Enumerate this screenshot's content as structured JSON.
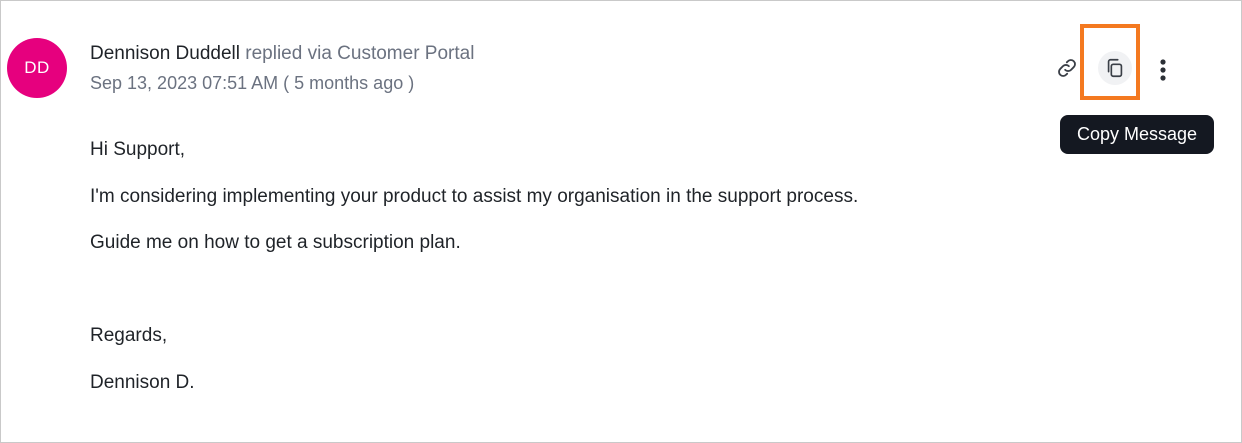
{
  "message": {
    "avatar_initials": "DD",
    "author": "Dennison Duddell",
    "action": "replied",
    "via": "via Customer Portal",
    "timestamp": "Sep 13, 2023 07:51 AM ( 5 months ago )",
    "body_lines": [
      "Hi Support,",
      "I'm considering implementing your product to assist my organisation in the support process.",
      "Guide me on how to get a subscription plan.",
      "Regards,",
      "Dennison D."
    ]
  },
  "actions": {
    "link_icon": "link-icon",
    "copy_icon": "copy-icon",
    "more_icon": "more-vertical-icon"
  },
  "tooltip": {
    "label": "Copy Message"
  },
  "colors": {
    "avatar_bg": "#e6007e",
    "highlight": "#f47920",
    "tooltip_bg": "#141821"
  }
}
